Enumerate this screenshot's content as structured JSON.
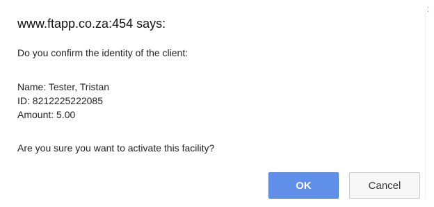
{
  "dialog": {
    "title": "www.ftapp.co.za:454 says:",
    "question": "Do you confirm the identity of the client:",
    "name_line": "Name: Tester, Tristan",
    "id_line": "ID: 8212225222085",
    "amount_line": "Amount: 5.00",
    "confirm_line": "Are you sure you want to activate this facility?",
    "ok_label": "OK",
    "cancel_label": "Cancel"
  },
  "colors": {
    "ok_button": "#5f8fe6",
    "cancel_button": "#f7f7f7",
    "background": "#ffffff"
  }
}
